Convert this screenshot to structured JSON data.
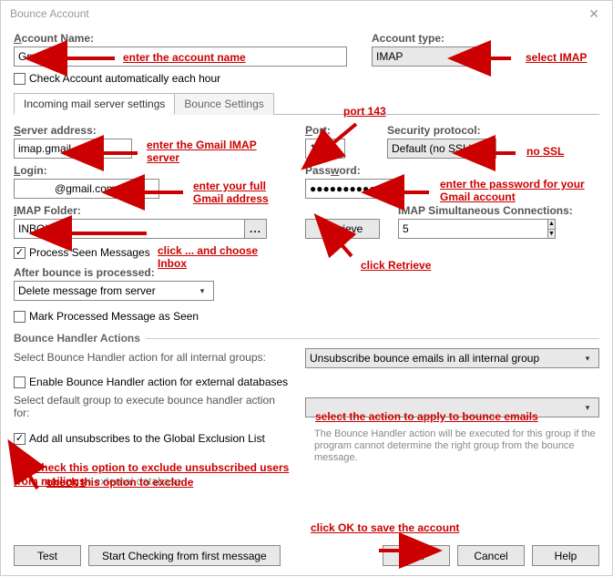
{
  "window": {
    "title": "Bounce Account"
  },
  "account_name": {
    "label": "Account Name:",
    "value": "Gmail"
  },
  "account_type": {
    "label": "Account type:",
    "value": "IMAP"
  },
  "check_auto": {
    "label": "Check Account automatically each hour"
  },
  "tabs": {
    "incoming": "Incoming mail server settings",
    "bounce": "Bounce Settings"
  },
  "server_address": {
    "label": "Server address:",
    "value": "imap.gmail.com"
  },
  "port": {
    "label": "Port:",
    "value": "143"
  },
  "security": {
    "label": "Security protocol:",
    "value": "Default (no SSL)"
  },
  "login": {
    "label": "Login:",
    "value": "            @gmail.com"
  },
  "password": {
    "label": "Password:",
    "value": "●●●●●●●●●●"
  },
  "imap_folder": {
    "label": "IMAP Folder:",
    "value": "INBOX",
    "browse": "..."
  },
  "retrieve": "Retrieve",
  "imap_conn": {
    "label": "IMAP Simultaneous Connections:",
    "value": "5"
  },
  "process_seen": {
    "label": "Process Seen Messages"
  },
  "after_bounce": {
    "label": "After bounce is processed:",
    "value": "Delete message from server"
  },
  "mark_seen": {
    "label": "Mark Processed Message as Seen"
  },
  "bha_title": "Bounce Handler Actions",
  "bha_internal_label": "Select Bounce Handler action for all internal groups:",
  "bha_internal_value": "Unsubscribe bounce emails in all internal group",
  "bha_external_enable": "Enable Bounce Handler action for external databases",
  "bha_default_group_label": "Select default group to execute bounce handler action for:",
  "bha_default_group_value": "",
  "add_unsub": "Add all unsubscribes to the Global Exclusion List",
  "help_text": "The Bounce Handler action will be executed for this group if the program cannot determine the right group from the bounce message.",
  "ext_db_text_prefix": "You ",
  "ext_db_text_suffix": "n external database",
  "buttons": {
    "test": "Test",
    "start": "Start Checking from first message",
    "ok": "OK",
    "cancel": "Cancel",
    "help": "Help"
  },
  "annotations": {
    "acct_name": "enter the account name",
    "acct_type": "select IMAP",
    "port143": "port 143",
    "server": "enter the Gmail IMAP server",
    "nossl": "no SSL",
    "login": "enter your full Gmail address",
    "pwd": "enter the password for your Gmail account",
    "folder": "click ... and choose Inbox",
    "retrieve": "click Retrieve",
    "bha": "select the action to apply to bounce emails",
    "unsub": "check this option to exclude unsubscribed users from mailings",
    "ok": "click OK to save the account"
  }
}
